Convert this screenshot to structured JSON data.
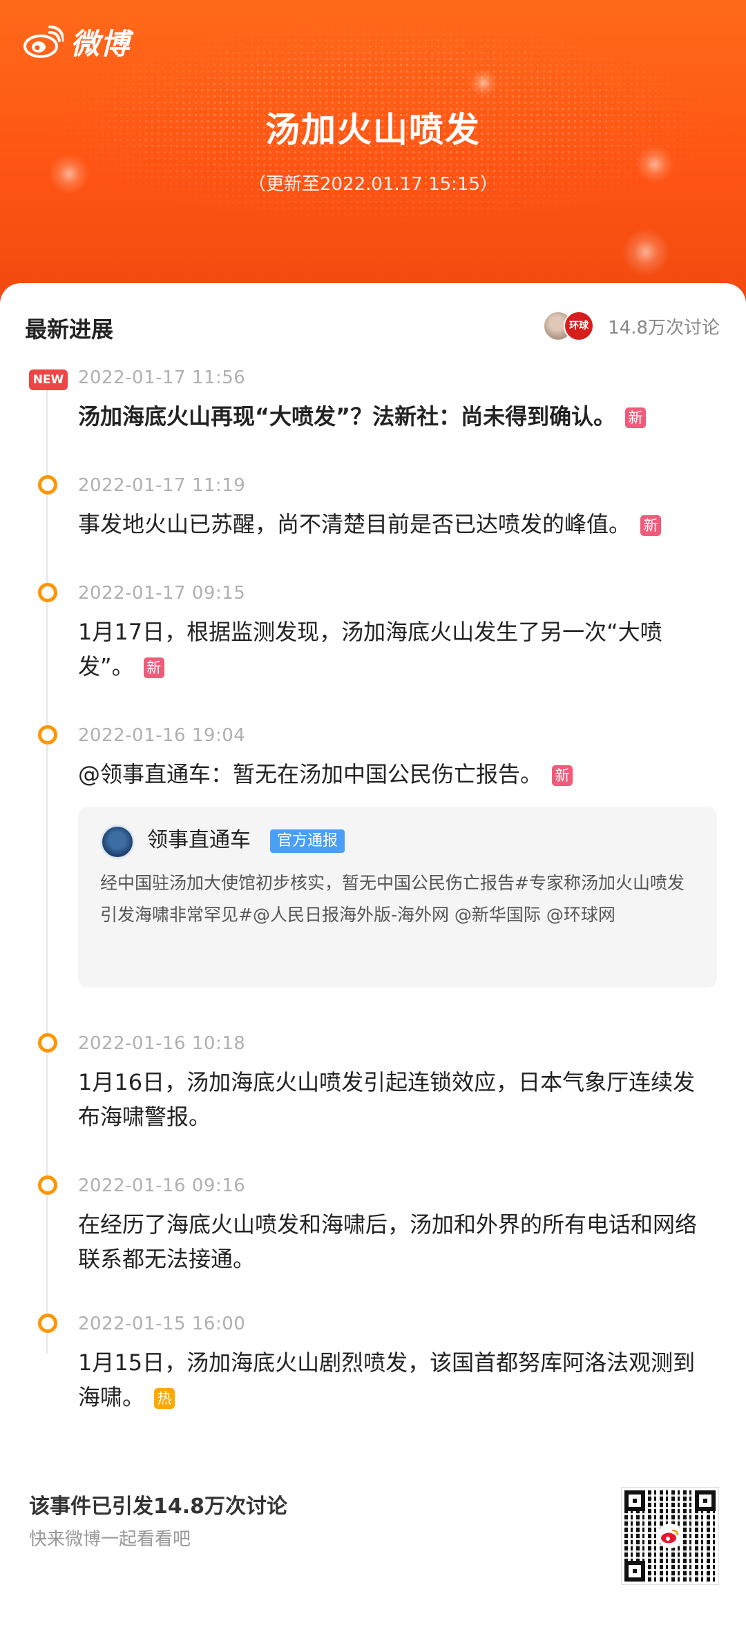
{
  "header": {
    "logo_text": "微博",
    "title": "汤加火山喷发",
    "updated": "（更新至2022.01.17 15:15）"
  },
  "section": {
    "title": "最新进展",
    "discussion_count": "14.8万次讨论",
    "avatar2_text": "环球"
  },
  "timeline": [
    {
      "marker": "NEW",
      "time": "2022-01-17 11:56",
      "text": "汤加海底火山再现“大喷发”？法新社：尚未得到确认。",
      "tag": "新",
      "bold": true
    },
    {
      "marker": "dot",
      "time": "2022-01-17 11:19",
      "text": "事发地火山已苏醒，尚不清楚目前是否已达喷发的峰值。",
      "tag": "新"
    },
    {
      "marker": "dot",
      "time": "2022-01-17 09:15",
      "text": "1月17日，根据监测发现，汤加海底火山发生了另一次“大喷发”。",
      "tag": "新"
    },
    {
      "marker": "dot",
      "time": "2022-01-16 19:04",
      "text": "@领事直通车：暂无在汤加中国公民伤亡报告。",
      "tag": "新",
      "quote": {
        "author": "领事直通车",
        "badge": "官方通报",
        "body": "经中国驻汤加大使馆初步核实，暂无中国公民伤亡报告#专家称汤加火山喷发引发海啸非常罕见#@人民日报海外版-海外网 @新华国际 @环球网"
      }
    },
    {
      "marker": "dot",
      "time": "2022-01-16 10:18",
      "text": "1月16日，汤加海底火山喷发引起连锁效应，日本气象厅连续发布海啸警报。"
    },
    {
      "marker": "dot",
      "time": "2022-01-16 09:16",
      "text": "在经历了海底火山喷发和海啸后，汤加和外界的所有电话和网络联系都无法接通。"
    },
    {
      "marker": "dot",
      "time": "2022-01-15 16:00",
      "text": "1月15日，汤加海底火山剧烈喷发，该国首都努库阿洛法观测到海啸。",
      "tag": "热"
    }
  ],
  "footer": {
    "main": "该事件已引发14.8万次讨论",
    "sub": "快来微博一起看看吧"
  },
  "colors": {
    "header_orange": "#ff5a14",
    "timeline_dot": "#ff9500",
    "new_badge": "#f04545",
    "tag_new": "#f05b7a",
    "tag_hot": "#ffa900",
    "official_badge": "#4a9ff5"
  }
}
